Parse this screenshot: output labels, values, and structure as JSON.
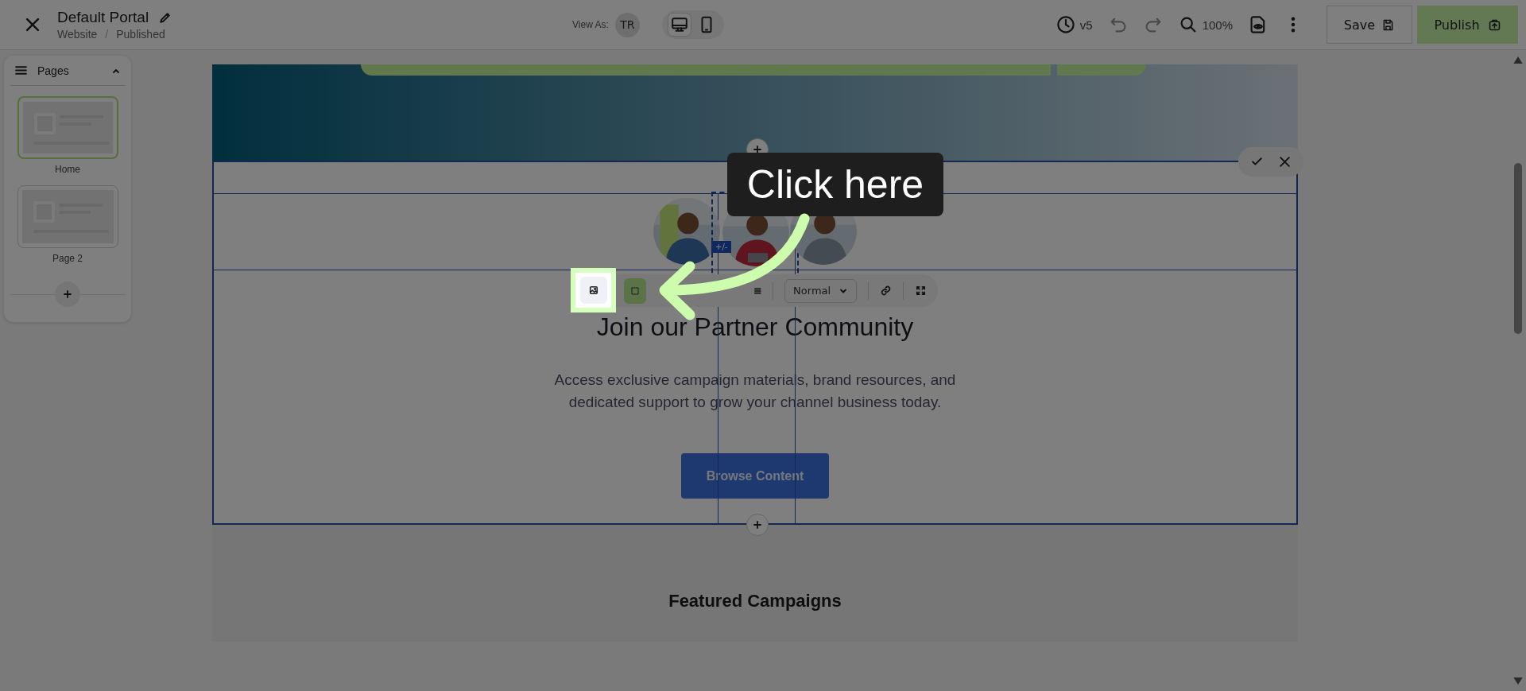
{
  "top_bar": {
    "title": "Default Portal",
    "breadcrumb": [
      "Website",
      "Published"
    ],
    "breadcrumb_separator": "/",
    "view_as_label": "View As:",
    "view_as_avatar": "TR",
    "devices": [
      {
        "kind": "desktop",
        "selected": true
      },
      {
        "kind": "mobile",
        "selected": false
      }
    ],
    "version": "v5",
    "zoom": "100%",
    "save": "Save",
    "publish": "Publish"
  },
  "pages_panel": {
    "title": "Pages",
    "expanded": true,
    "pages": [
      {
        "name": "Home",
        "selected": true
      },
      {
        "name": "Page 2",
        "selected": false
      }
    ]
  },
  "section": {
    "images": [
      {
        "kind": "picture",
        "selected": false
      },
      {
        "kind": "picture",
        "selected": true
      },
      {
        "kind": "picture",
        "selected": false
      }
    ],
    "selection_badge": "+/-",
    "heading": "Join our Partner Community",
    "text": "Access exclusive campaign materials, brand resources, and dedicated support to grow your channel business today.",
    "button": "Browse Content"
  },
  "toolbar": {
    "style": "Normal"
  },
  "next_section": {
    "heading": "Featured Campaigns"
  },
  "tutorial": {
    "callout": "Click here"
  }
}
